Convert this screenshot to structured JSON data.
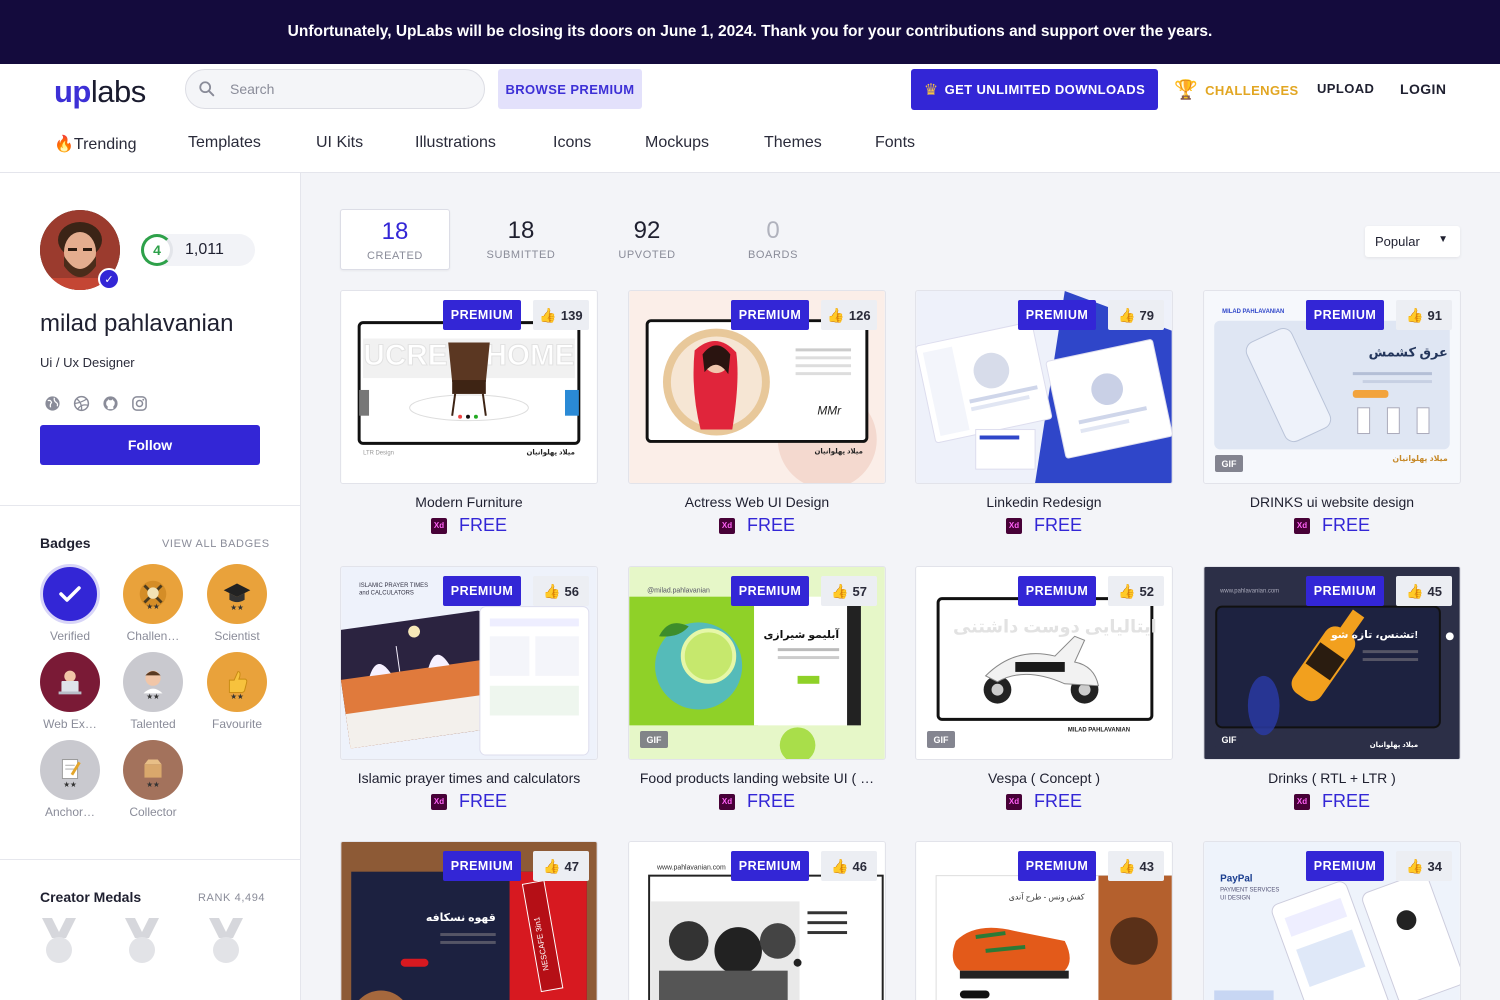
{
  "banner": {
    "text": "Unfortunately, UpLabs will be closing its doors on June 1, 2024. Thank you for your contributions and support over the years."
  },
  "header": {
    "logo_up": "up",
    "logo_labs": "labs",
    "search_placeholder": "Search",
    "browse_premium": "BROWSE PREMIUM",
    "unlimited": "GET UNLIMITED DOWNLOADS",
    "challenges": "CHALLENGES",
    "upload": "UPLOAD",
    "login": "LOGIN"
  },
  "nav": {
    "items": [
      "🔥Trending",
      "Templates",
      "UI Kits",
      "Illustrations",
      "Icons",
      "Mockups",
      "Themes",
      "Fonts"
    ]
  },
  "profile": {
    "level": "4",
    "points": "1,011",
    "name": "milad pahlavanian",
    "role": "Ui / Ux Designer",
    "follow": "Follow"
  },
  "badges": {
    "title": "Badges",
    "view_all": "VIEW ALL BADGES",
    "items": [
      {
        "label": "Verified",
        "color": "#3326d6",
        "icon": "check-icon"
      },
      {
        "label": "Challen…",
        "color": "#e9a23b",
        "icon": "trophy-icon"
      },
      {
        "label": "Scientist",
        "color": "#e9a23b",
        "icon": "graduation-cap-icon"
      },
      {
        "label": "Web Ex…",
        "color": "#7a1a36",
        "icon": "laptop-icon"
      },
      {
        "label": "Talented",
        "color": "#c9c9cf",
        "icon": "person-icon"
      },
      {
        "label": "Favourite",
        "color": "#e9a23b",
        "icon": "thumbs-up-icon"
      },
      {
        "label": "Anchor…",
        "color": "#c9c9cf",
        "icon": "notepad-icon"
      },
      {
        "label": "Collector",
        "color": "#a3725c",
        "icon": "box-icon"
      }
    ]
  },
  "medals": {
    "title": "Creator Medals",
    "rank": "RANK 4,494"
  },
  "stats": [
    {
      "num": "18",
      "label": "CREATED"
    },
    {
      "num": "18",
      "label": "SUBMITTED"
    },
    {
      "num": "92",
      "label": "UPVOTED"
    },
    {
      "num": "0",
      "label": "BOARDS"
    }
  ],
  "sort": {
    "value": "Popular"
  },
  "card_common": {
    "premium": "PREMIUM",
    "free": "FREE",
    "xd": "Xd",
    "gif": "GIF"
  },
  "cards": [
    {
      "title": "Modern Furniture",
      "likes": "139",
      "gif": false
    },
    {
      "title": "Actress Web UI Design",
      "likes": "126",
      "gif": false
    },
    {
      "title": "Linkedin Redesign",
      "likes": "79",
      "gif": false
    },
    {
      "title": "DRINKS ui website design",
      "likes": "91",
      "gif": true
    },
    {
      "title": "Islamic prayer times and calculators",
      "likes": "56",
      "gif": false
    },
    {
      "title": "Food products landing website UI ( …",
      "likes": "57",
      "gif": true
    },
    {
      "title": "Vespa ( Concept )",
      "likes": "52",
      "gif": true
    },
    {
      "title": "Drinks ( RTL + LTR )",
      "likes": "45",
      "gif": true
    },
    {
      "title": "",
      "likes": "47",
      "gif": false
    },
    {
      "title": "",
      "likes": "46",
      "gif": false
    },
    {
      "title": "",
      "likes": "43",
      "gif": false
    },
    {
      "title": "",
      "likes": "34",
      "gif": false
    }
  ]
}
